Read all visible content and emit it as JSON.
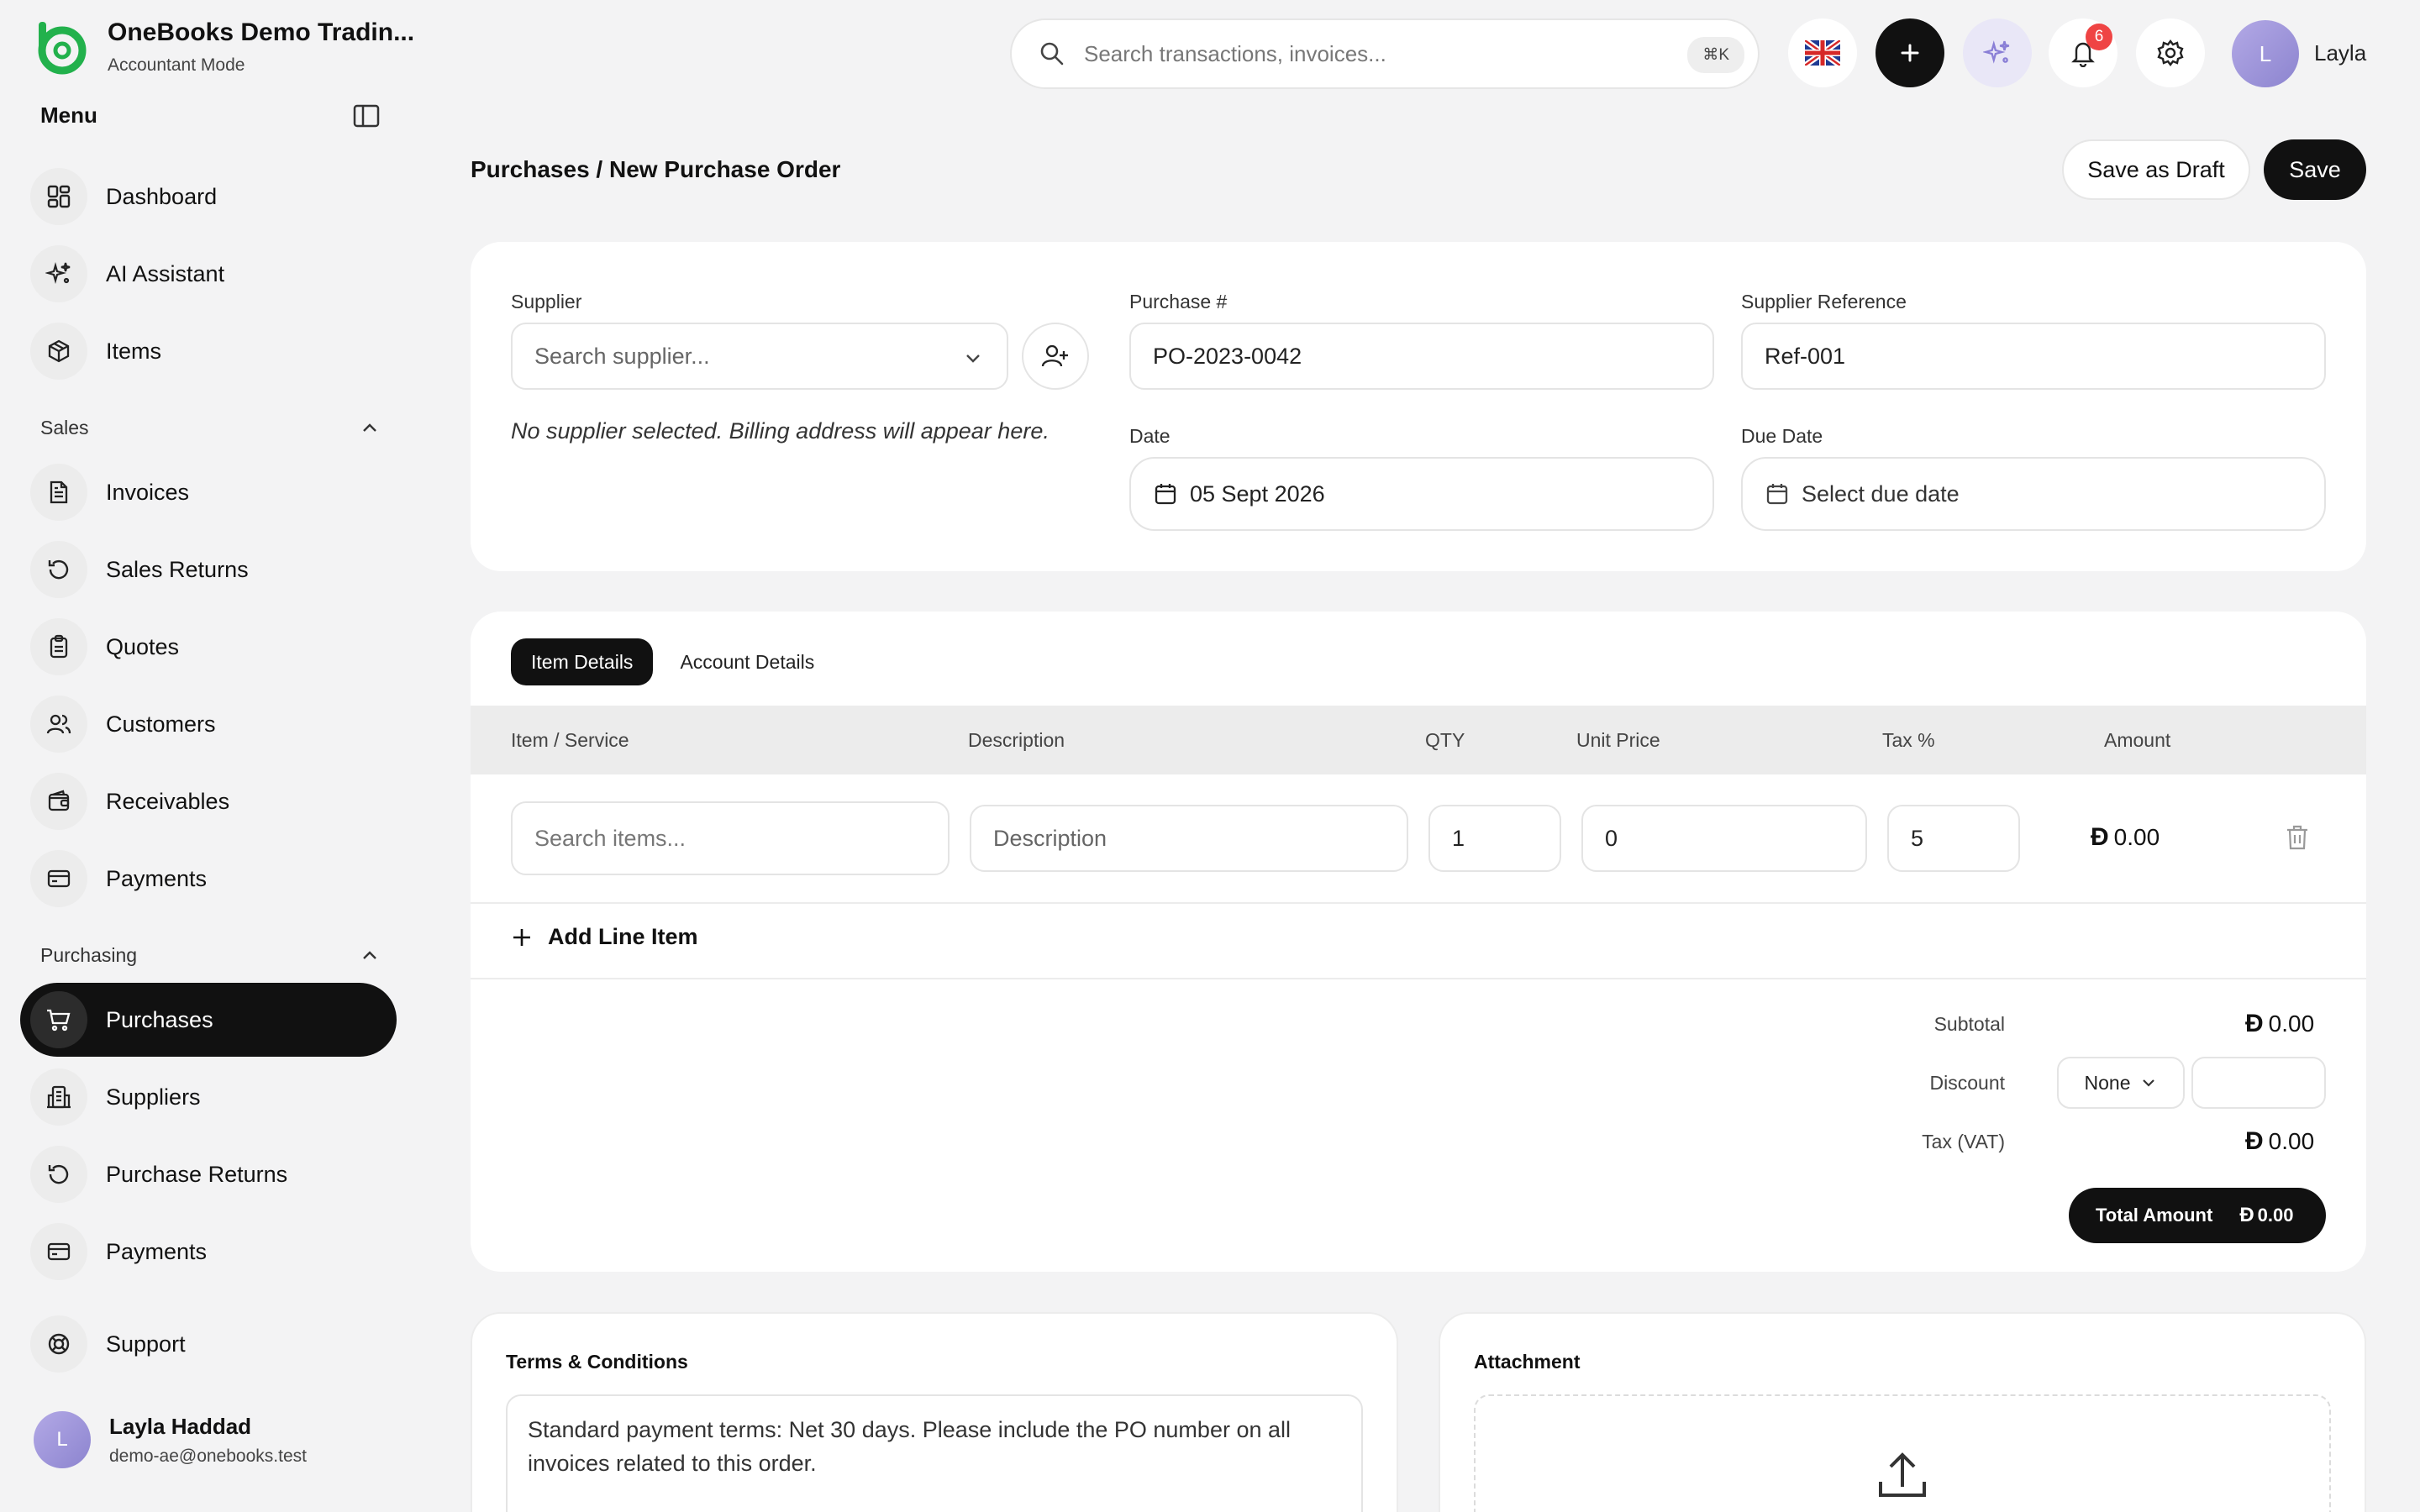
{
  "app": {
    "company_name": "OneBooks Demo Tradin...",
    "mode": "Accountant Mode"
  },
  "sidebar": {
    "menu_title": "Menu",
    "top_items": [
      {
        "label": "Dashboard",
        "icon": "dashboard-icon"
      },
      {
        "label": "AI Assistant",
        "icon": "sparkles-icon"
      },
      {
        "label": "Items",
        "icon": "box-icon"
      }
    ],
    "sales": {
      "title": "Sales",
      "items": [
        {
          "label": "Invoices",
          "icon": "invoice-icon"
        },
        {
          "label": "Sales Returns",
          "icon": "return-icon"
        },
        {
          "label": "Quotes",
          "icon": "clipboard-icon"
        },
        {
          "label": "Customers",
          "icon": "users-icon"
        },
        {
          "label": "Receivables",
          "icon": "wallet-icon"
        },
        {
          "label": "Payments",
          "icon": "card-icon"
        }
      ]
    },
    "purchasing": {
      "title": "Purchasing",
      "items": [
        {
          "label": "Purchases",
          "icon": "cart-icon",
          "active": true
        },
        {
          "label": "Suppliers",
          "icon": "building-icon"
        },
        {
          "label": "Purchase Returns",
          "icon": "return-icon"
        },
        {
          "label": "Payments",
          "icon": "card-icon"
        }
      ]
    },
    "support_label": "Support",
    "user": {
      "initial": "L",
      "name": "Layla Haddad",
      "email": "demo-ae@onebooks.test"
    }
  },
  "topbar": {
    "search_placeholder": "Search transactions, invoices...",
    "search_shortcut": "⌘K",
    "notification_count": "6",
    "user_initial": "L",
    "user_name": "Layla"
  },
  "page": {
    "breadcrumb": "Purchases / New Purchase Order",
    "save_draft_label": "Save as Draft",
    "save_label": "Save"
  },
  "form": {
    "supplier_label": "Supplier",
    "supplier_placeholder": "Search supplier...",
    "no_supplier_note": "No supplier selected. Billing address will appear here.",
    "purchase_no_label": "Purchase #",
    "purchase_no_value": "PO-2023-0042",
    "supplier_ref_label": "Supplier Reference",
    "supplier_ref_value": "Ref-001",
    "date_label": "Date",
    "date_value": "05 Sept 2026",
    "due_date_label": "Due Date",
    "due_date_placeholder": "Select due date"
  },
  "lines": {
    "tabs": [
      "Item Details",
      "Account Details"
    ],
    "columns": {
      "item": "Item / Service",
      "description": "Description",
      "qty": "QTY",
      "unit_price": "Unit Price",
      "tax": "Tax %",
      "amount": "Amount"
    },
    "row": {
      "item_placeholder": "Search items...",
      "description_placeholder": "Description",
      "qty": "1",
      "unit_price": "0",
      "tax": "5",
      "amount": "0.00"
    },
    "add_line_label": "Add Line Item"
  },
  "totals": {
    "currency_symbol": "Đ",
    "subtotal_label": "Subtotal",
    "subtotal_value": "0.00",
    "discount_label": "Discount",
    "discount_type": "None",
    "tax_label": "Tax (VAT)",
    "tax_value": "0.00",
    "total_label": "Total Amount",
    "total_value": "0.00"
  },
  "terms": {
    "title": "Terms & Conditions",
    "text": "Standard payment terms: Net 30 days. Please include the PO number on all invoices related to this order."
  },
  "attachment": {
    "title": "Attachment"
  },
  "colors": {
    "brand_green": "#22b14c",
    "accent_dark": "#111111",
    "badge_red": "#ef4444",
    "avatar_purple": "#a79ee0"
  }
}
